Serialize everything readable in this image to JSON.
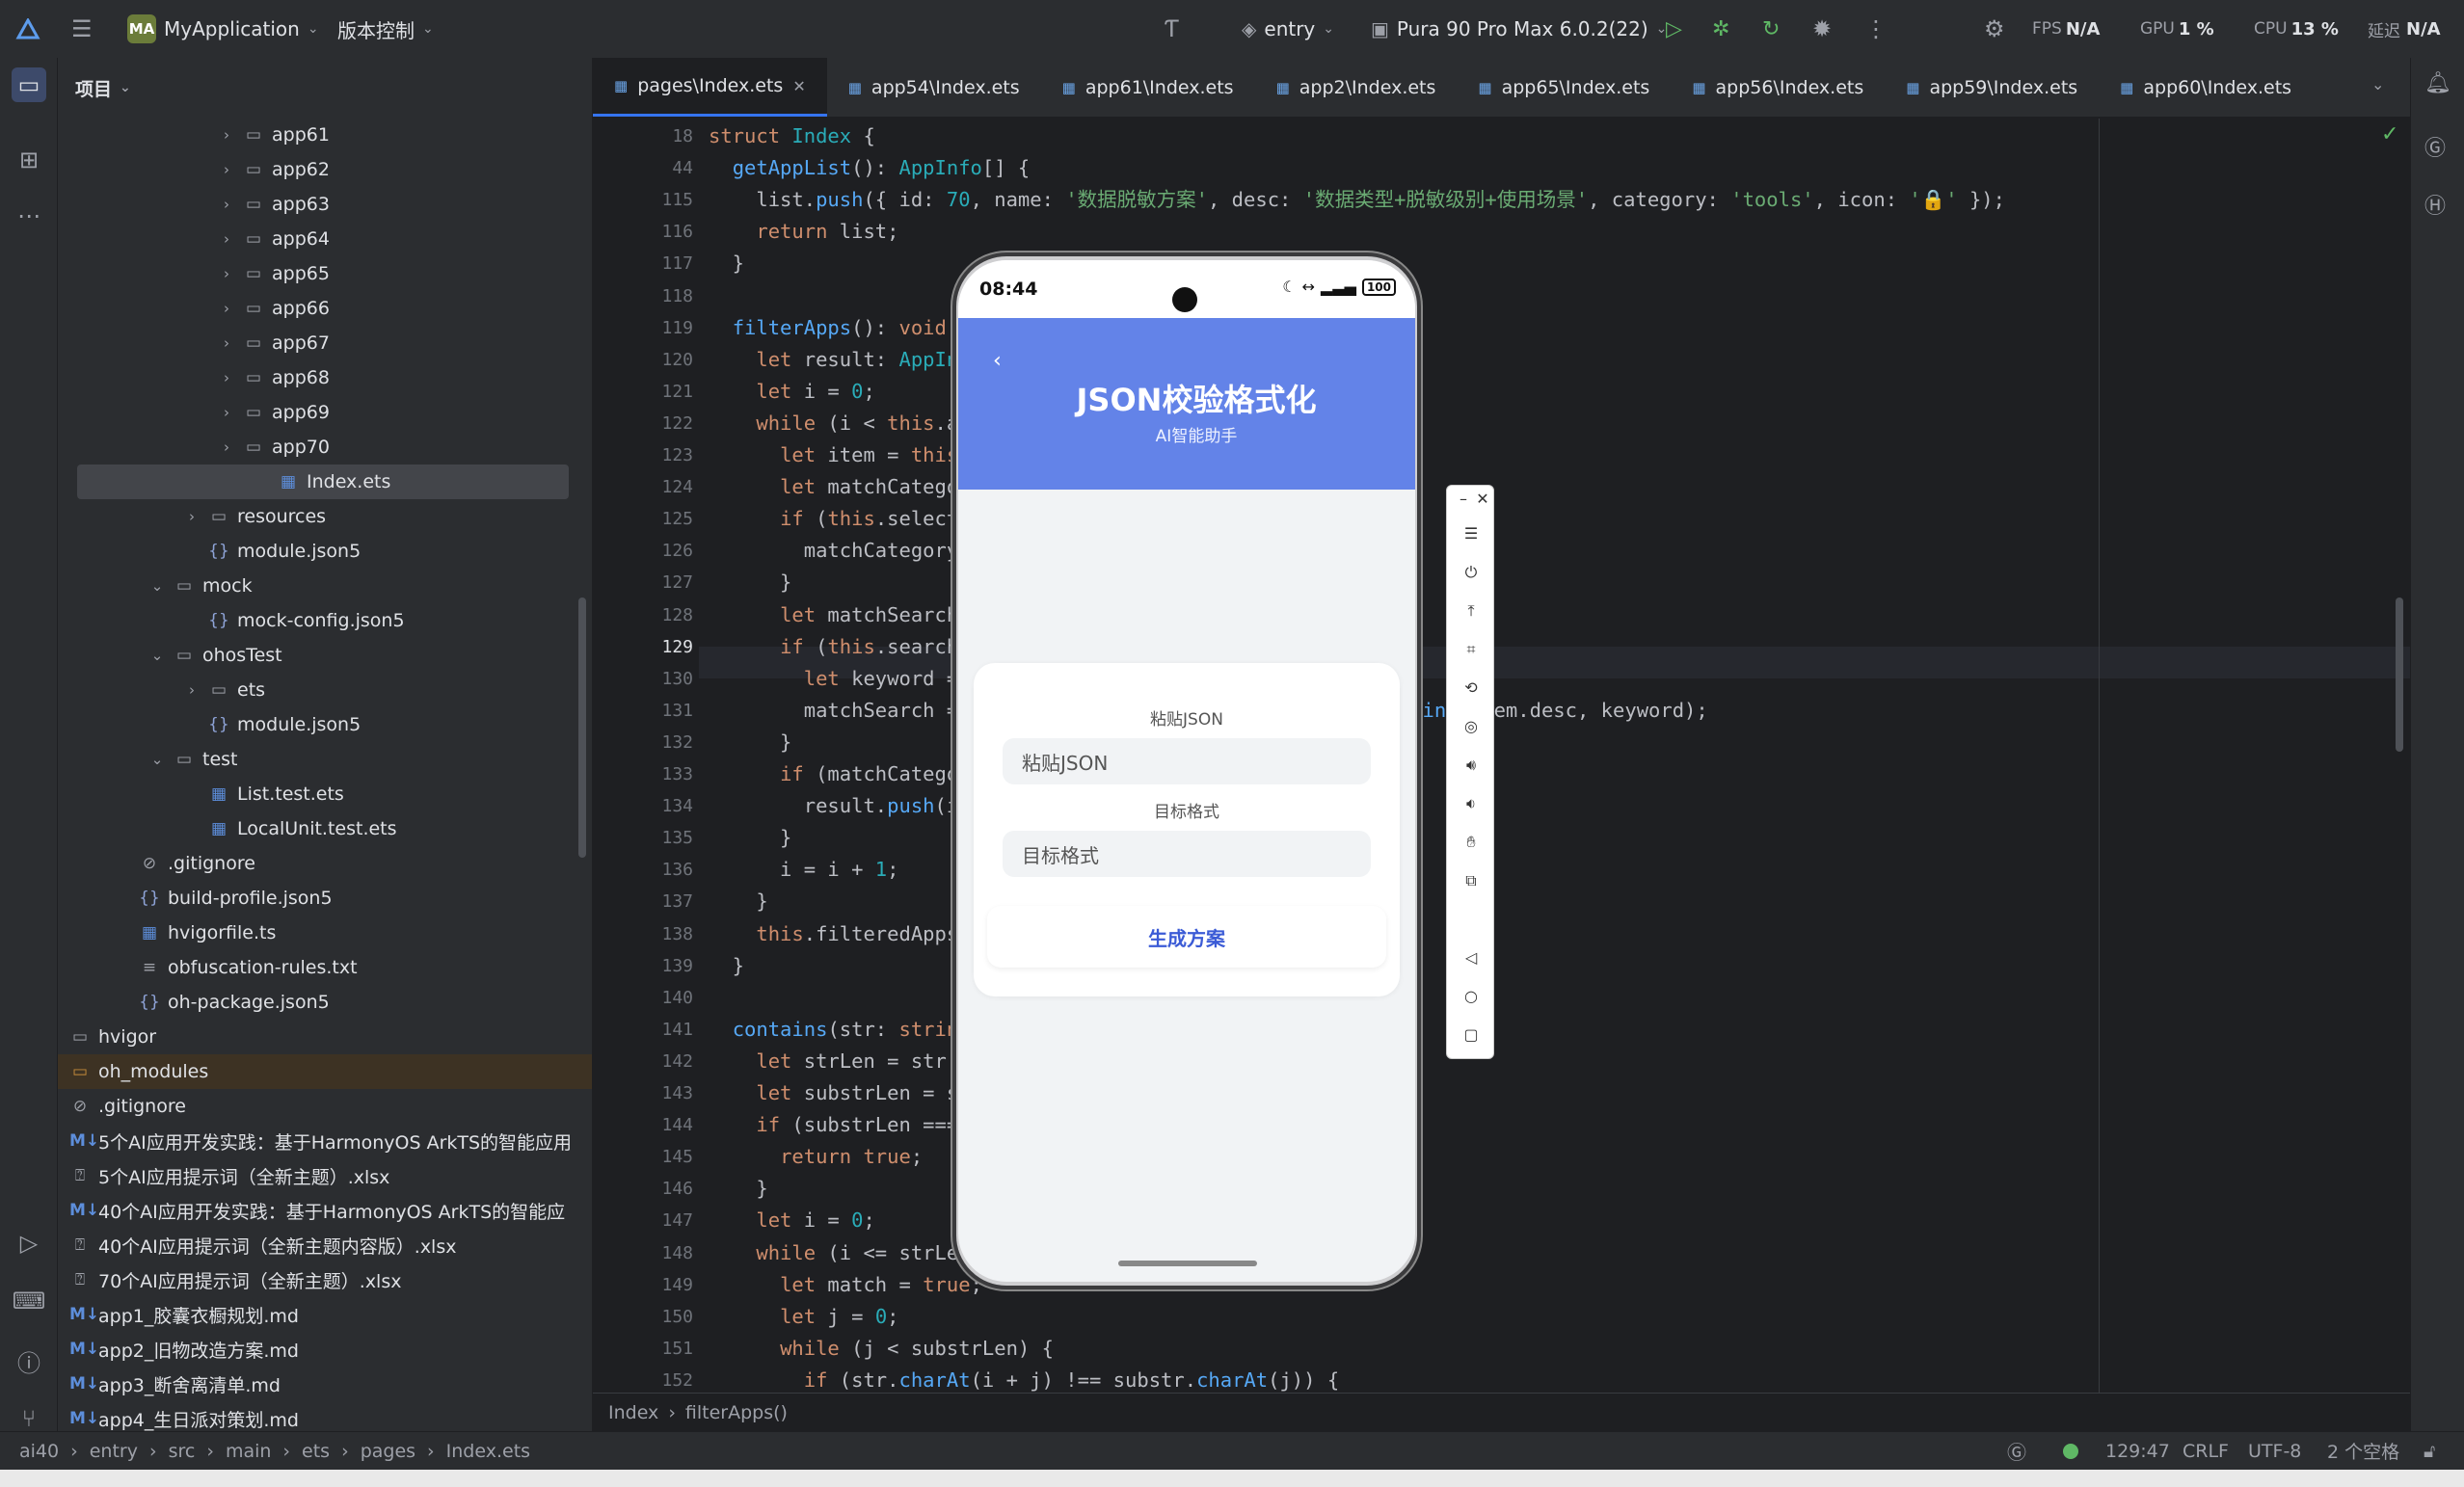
{
  "titlebar": {
    "app_badge": "MA",
    "project_name": "MyApplication",
    "vcs": "版本控制",
    "run_config": "entry",
    "device": "Pura 90 Pro Max 6.0.2(22)",
    "fps_label": "FPS",
    "fps_value": "N/A",
    "gpu_label": "GPU",
    "gpu_value": "1 %",
    "cpu_label": "CPU",
    "cpu_value": "13 %",
    "latency_label": "延迟",
    "latency_value": "N/A"
  },
  "project": {
    "header": "项目",
    "tree": [
      {
        "label": "app61",
        "type": "folder",
        "arrow": "›",
        "indent": 2
      },
      {
        "label": "app62",
        "type": "folder",
        "arrow": "›",
        "indent": 2
      },
      {
        "label": "app63",
        "type": "folder",
        "arrow": "›",
        "indent": 2
      },
      {
        "label": "app64",
        "type": "folder",
        "arrow": "›",
        "indent": 2
      },
      {
        "label": "app65",
        "type": "folder",
        "arrow": "›",
        "indent": 2
      },
      {
        "label": "app66",
        "type": "folder",
        "arrow": "›",
        "indent": 2
      },
      {
        "label": "app67",
        "type": "folder",
        "arrow": "›",
        "indent": 2
      },
      {
        "label": "app68",
        "type": "folder",
        "arrow": "›",
        "indent": 2
      },
      {
        "label": "app69",
        "type": "folder",
        "arrow": "›",
        "indent": 2
      },
      {
        "label": "app70",
        "type": "folder",
        "arrow": "›",
        "indent": 2
      },
      {
        "label": "Index.ets",
        "type": "ets",
        "arrow": "",
        "indent": 3,
        "selected": true
      },
      {
        "label": "resources",
        "type": "folder",
        "arrow": "›",
        "indent": 1
      },
      {
        "label": "module.json5",
        "type": "json",
        "arrow": "",
        "indent": 1
      },
      {
        "label": "mock",
        "type": "folder",
        "arrow": "⌄",
        "indent": 0
      },
      {
        "label": "mock-config.json5",
        "type": "json",
        "arrow": "",
        "indent": 1
      },
      {
        "label": "ohosTest",
        "type": "folder",
        "arrow": "⌄",
        "indent": 0
      },
      {
        "label": "ets",
        "type": "folder",
        "arrow": "›",
        "indent": 1
      },
      {
        "label": "module.json5",
        "type": "json",
        "arrow": "",
        "indent": 1
      },
      {
        "label": "test",
        "type": "folder",
        "arrow": "⌄",
        "indent": 0
      },
      {
        "label": "List.test.ets",
        "type": "ets",
        "arrow": "",
        "indent": 1
      },
      {
        "label": "LocalUnit.test.ets",
        "type": "ets",
        "arrow": "",
        "indent": 1
      },
      {
        "label": ".gitignore",
        "type": "ignore",
        "arrow": "",
        "indent": -1
      },
      {
        "label": "build-profile.json5",
        "type": "json",
        "arrow": "",
        "indent": -1
      },
      {
        "label": "hvigorfile.ts",
        "type": "ets",
        "arrow": "",
        "indent": -1
      },
      {
        "label": "obfuscation-rules.txt",
        "type": "txt",
        "arrow": "",
        "indent": -1
      },
      {
        "label": "oh-package.json5",
        "type": "json",
        "arrow": "",
        "indent": -1
      },
      {
        "label": "hvigor",
        "type": "folder",
        "arrow": "›",
        "indent": -3
      },
      {
        "label": "oh_modules",
        "type": "folder-orange",
        "arrow": "›",
        "indent": -3,
        "highlight": true
      },
      {
        "label": ".gitignore",
        "type": "ignore",
        "arrow": "",
        "indent": -3
      },
      {
        "label": "5个AI应用开发实践：基于HarmonyOS ArkTS的智能应用",
        "type": "md",
        "arrow": "",
        "indent": -3
      },
      {
        "label": "5个AI应用提示词（全新主题）.xlsx",
        "type": "xlsx",
        "arrow": "",
        "indent": -3
      },
      {
        "label": "40个AI应用开发实践：基于HarmonyOS ArkTS的智能应",
        "type": "md",
        "arrow": "",
        "indent": -3
      },
      {
        "label": "40个AI应用提示词（全新主题内容版）.xlsx",
        "type": "xlsx",
        "arrow": "",
        "indent": -3
      },
      {
        "label": "70个AI应用提示词（全新主题）.xlsx",
        "type": "xlsx",
        "arrow": "",
        "indent": -3
      },
      {
        "label": "app1_胶囊衣橱规划.md",
        "type": "md",
        "arrow": "",
        "indent": -3
      },
      {
        "label": "app2_旧物改造方案.md",
        "type": "md",
        "arrow": "",
        "indent": -3
      },
      {
        "label": "app3_断舍离清单.md",
        "type": "md",
        "arrow": "",
        "indent": -3
      },
      {
        "label": "app4_生日派对策划.md",
        "type": "md",
        "arrow": "",
        "indent": -3
      }
    ]
  },
  "tabs": [
    {
      "label": "pages\\Index.ets",
      "active": true
    },
    {
      "label": "app54\\Index.ets"
    },
    {
      "label": "app61\\Index.ets"
    },
    {
      "label": "app2\\Index.ets"
    },
    {
      "label": "app65\\Index.ets"
    },
    {
      "label": "app56\\Index.ets"
    },
    {
      "label": "app59\\Index.ets"
    },
    {
      "label": "app60\\Index.ets"
    }
  ],
  "editor": {
    "lines": [
      {
        "n": "18",
        "html": "<span class='kw'>struct</span> <span class='ty'>Index</span> {",
        "indent": 0
      },
      {
        "n": "44",
        "html": "  <span class='fn'>getAppList</span>(): <span class='ty'>AppInfo</span>[] {",
        "indent": 0
      },
      {
        "n": "115",
        "html": "    list.<span class='fn'>push</span>({ id: <span class='nu'>70</span>, name: <span class='st'>'数据脱敏方案'</span>, desc: <span class='st'>'数据类型+脱敏级别+使用场景'</span>, category: <span class='st'>'tools'</span>, icon: <span class='st'>'🔒'</span> });",
        "indent": 0
      },
      {
        "n": "116",
        "html": "    <span class='kw'>return</span> list;",
        "indent": 0
      },
      {
        "n": "117",
        "html": "  }",
        "indent": 0
      },
      {
        "n": "118",
        "html": "",
        "indent": 0
      },
      {
        "n": "119",
        "html": "  <span class='fn'>filterApps</span>(): <span class='kw'>void</span>",
        "indent": 0
      },
      {
        "n": "120",
        "html": "    <span class='kw'>let</span> result: <span class='ty'>AppIn</span>",
        "indent": 0
      },
      {
        "n": "121",
        "html": "    <span class='kw'>let</span> i = <span class='nu'>0</span>;",
        "indent": 0
      },
      {
        "n": "122",
        "html": "    <span class='kw'>while</span> (i &lt; <span class='kw'>this</span>.a",
        "indent": 0
      },
      {
        "n": "123",
        "html": "      <span class='kw'>let</span> item = <span class='kw'>this</span>",
        "indent": 0
      },
      {
        "n": "124",
        "html": "      <span class='kw'>let</span> matchCatego",
        "indent": 0
      },
      {
        "n": "125",
        "html": "      <span class='kw'>if</span> (<span class='kw'>this</span>.select",
        "indent": 0
      },
      {
        "n": "126",
        "html": "        matchCategory                                 ory",
        "indent": 0
      },
      {
        "n": "127",
        "html": "      }",
        "indent": 0
      },
      {
        "n": "128",
        "html": "      <span class='kw'>let</span> matchSearch",
        "indent": 0
      },
      {
        "n": "129",
        "html": "      <span class='kw'>if</span> (<span class='kw'>this</span>.search",
        "indent": 0
      },
      {
        "n": "130",
        "html": "        <span class='kw'>let</span> keyword =",
        "indent": 0
      },
      {
        "n": "131",
        "html": "        matchSearch =                                s.<span class='fn'>contains</span>(item.desc, keyword);",
        "indent": 0
      },
      {
        "n": "132",
        "html": "      }",
        "indent": 0
      },
      {
        "n": "133",
        "html": "      <span class='kw'>if</span> (matchCatego",
        "indent": 0
      },
      {
        "n": "134",
        "html": "        result.<span class='fn'>push</span>(i",
        "indent": 0
      },
      {
        "n": "135",
        "html": "      }",
        "indent": 0
      },
      {
        "n": "136",
        "html": "      i = i + <span class='nu'>1</span>;",
        "indent": 0
      },
      {
        "n": "137",
        "html": "    }",
        "indent": 0
      },
      {
        "n": "138",
        "html": "    <span class='kw'>this</span>.filteredApps",
        "indent": 0
      },
      {
        "n": "139",
        "html": "  }",
        "indent": 0
      },
      {
        "n": "140",
        "html": "",
        "indent": 0
      },
      {
        "n": "141",
        "html": "  <span class='fn'>contains</span>(str: <span class='kw'>strin</span>",
        "indent": 0
      },
      {
        "n": "142",
        "html": "    <span class='kw'>let</span> strLen = str.",
        "indent": 0
      },
      {
        "n": "143",
        "html": "    <span class='kw'>let</span> substrLen = s",
        "indent": 0
      },
      {
        "n": "144",
        "html": "    <span class='kw'>if</span> (substrLen ===",
        "indent": 0
      },
      {
        "n": "145",
        "html": "      <span class='kw'>return true</span>;",
        "indent": 0
      },
      {
        "n": "146",
        "html": "    }",
        "indent": 0
      },
      {
        "n": "147",
        "html": "    <span class='kw'>let</span> i = <span class='nu'>0</span>;",
        "indent": 0
      },
      {
        "n": "148",
        "html": "    <span class='kw'>while</span> (i &lt;= strLe",
        "indent": 0
      },
      {
        "n": "149",
        "html": "      <span class='kw'>let</span> match = <span class='kw'>true</span>;",
        "indent": 0
      },
      {
        "n": "150",
        "html": "      <span class='kw'>let</span> j = <span class='nu'>0</span>;",
        "indent": 0
      },
      {
        "n": "151",
        "html": "      <span class='kw'>while</span> (j &lt; substrLen) {",
        "indent": 0
      },
      {
        "n": "152",
        "html": "        <span class='kw'>if</span> (str.<span class='fn'>charAt</span>(i + j) !== substr.<span class='fn'>charAt</span>(j)) {",
        "indent": 0
      }
    ]
  },
  "breadcrumb": {
    "a": "Index",
    "b": "filterApps()"
  },
  "statusbar": {
    "path": [
      "ai40",
      "entry",
      "src",
      "main",
      "ets",
      "pages",
      "Index.ets"
    ],
    "position": "129:47",
    "line_sep": "CRLF",
    "encoding": "UTF-8",
    "indent": "2 个空格"
  },
  "phone": {
    "time": "08:44",
    "battery": "100",
    "title": "JSON校验格式化",
    "subtitle": "AI智能助手",
    "field1_label": "粘贴JSON",
    "field1_placeholder": "粘贴JSON",
    "field2_label": "目标格式",
    "field2_placeholder": "目标格式",
    "generate_button": "生成方案",
    "header_color": "#6383e8"
  },
  "colors": {
    "accent": "#3574f0",
    "background": "#1e1f22",
    "panel": "#2b2d30"
  }
}
